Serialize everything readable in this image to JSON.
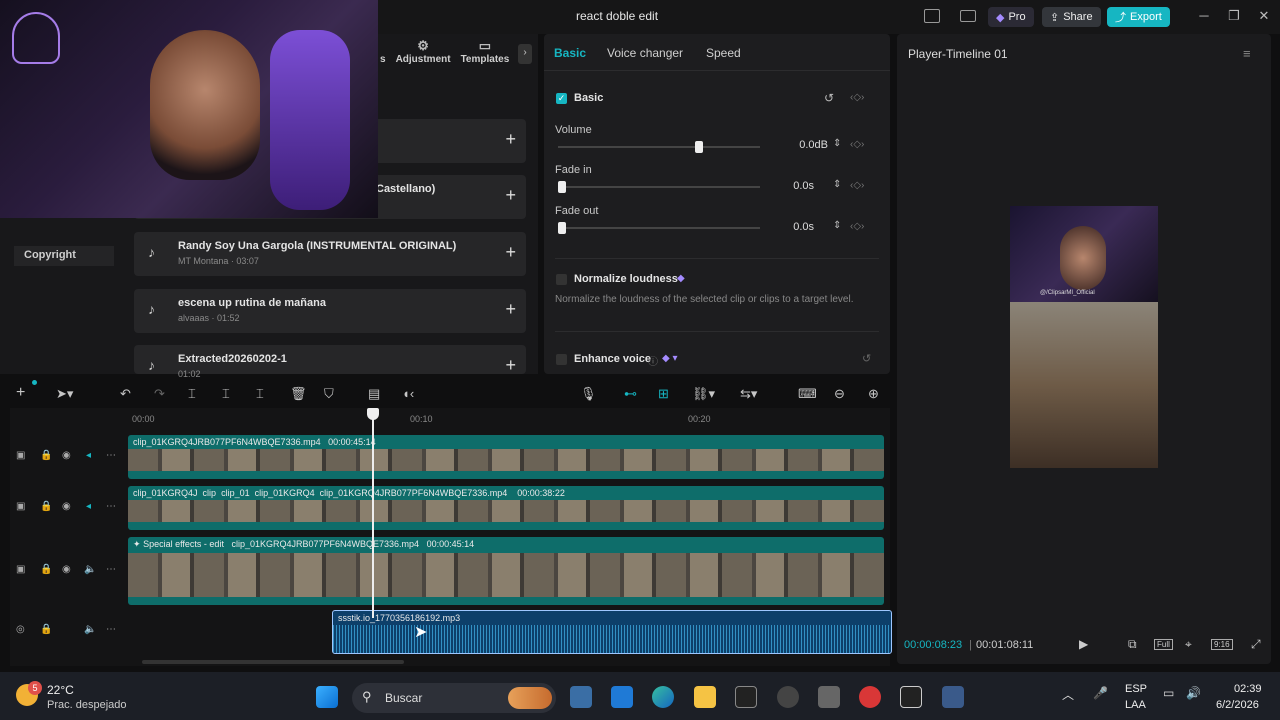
{
  "titlebar": {
    "title": "react doble edit",
    "pro": "Pro",
    "share": "Share",
    "export": "Export"
  },
  "media_panel": {
    "tabs": [
      "s",
      "Adjustment",
      "Templates"
    ],
    "sidebar_label": "Copyright",
    "cards": [
      {
        "title": "",
        "sub": ""
      },
      {
        "title": "Castellano)",
        "sub": ""
      },
      {
        "title": "Randy Soy Una Gargola (INSTRUMENTAL ORIGINAL)",
        "sub": "MT Montana · 03:07"
      },
      {
        "title": "escena up rutina de mañana",
        "sub": "alvaaas · 01:52"
      },
      {
        "title": "Extracted20260202-1",
        "sub": "01:02"
      }
    ]
  },
  "properties": {
    "tabs": [
      "Basic",
      "Voice changer",
      "Speed"
    ],
    "section": "Basic",
    "volume_label": "Volume",
    "volume_value": "0.0dB",
    "volume_level": 0.68,
    "fadein_label": "Fade in",
    "fadein_value": "0.0s",
    "fadeout_label": "Fade out",
    "fadeout_value": "0.0s",
    "normalize_label": "Normalize loudness",
    "normalize_desc": "Normalize the loudness of the selected clip or clips to a target level.",
    "enhance_label": "Enhance voice"
  },
  "player": {
    "title": "Player-Timeline 01",
    "current": "00:00:08:23",
    "total": "00:01:08:11",
    "ratio": "9:16",
    "full": "Full",
    "video_caption": "@/ClipsarMI_Official"
  },
  "timeline": {
    "ticks": [
      "00:00",
      "00:10",
      "00:20"
    ],
    "track1": {
      "label": "clip_01KGRQ4JRB077PF6N4WBQE7336.mp4",
      "duration": "00:00:45:14"
    },
    "track2": {
      "labels": [
        "clip_01KGRQ4J",
        "clip",
        "clip_01",
        "clip_01KGRQ4",
        "clip_01KGRQ4JRB077PF6N4WBQE7336.mp4"
      ],
      "duration": "00:00:38:22"
    },
    "track3": {
      "effect": "Special effects - edit",
      "label": "clip_01KGRQ4JRB077PF6N4WBQE7336.mp4",
      "duration": "00:00:45:14"
    },
    "audio": {
      "label": "ssstik.io_1770356186192.mp3"
    }
  },
  "taskbar": {
    "temp": "22°C",
    "weather": "Prac. despejado",
    "search": "Buscar",
    "lang1": "ESP",
    "lang2": "LAA",
    "time": "02:39",
    "date": "6/2/2026",
    "badge": "5"
  }
}
